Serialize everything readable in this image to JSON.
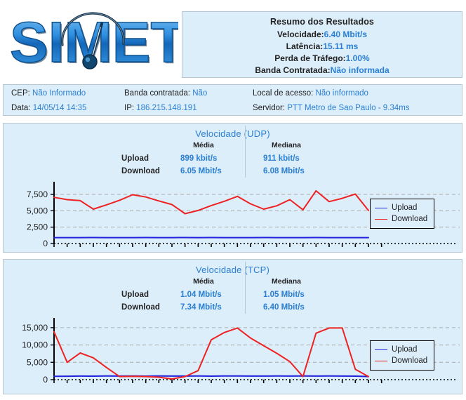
{
  "brand": {
    "name": "SIMET"
  },
  "summary": {
    "title": "Resumo dos Resultados",
    "rows": [
      {
        "label": "Velocidade:",
        "value": "6.40 Mbit/s"
      },
      {
        "label": "Latência:",
        "value": "15.11 ms"
      },
      {
        "label": "Perda de Tráfego:",
        "value": "1.00%"
      },
      {
        "label": "Banda Contratada:",
        "value": "Não informada"
      }
    ]
  },
  "info": {
    "cep_label": "CEP:",
    "cep_value": "Não Informado",
    "banda_label": "Banda contratada:",
    "banda_value": "Não",
    "local_label": "Local de acesso:",
    "local_value": "Não informado",
    "data_label": "Data:",
    "data_value": "14/05/14 14:35",
    "ip_label": "IP:",
    "ip_value": "186.215.148.191",
    "servidor_label": "Servidor:",
    "servidor_value": "PTT Metro de Sao Paulo - 9.34ms"
  },
  "legend": {
    "upload": "Upload",
    "download": "Download"
  },
  "stats_headers": {
    "media": "Média",
    "mediana": "Mediana",
    "upload": "Upload",
    "download": "Download"
  },
  "udp": {
    "title": "Velocidade (UDP)",
    "upload_media": "899 kbit/s",
    "upload_mediana": "911 kbit/s",
    "download_media": "6.05 Mbit/s",
    "download_mediana": "6.08 Mbit/s"
  },
  "tcp": {
    "title": "Velocidade (TCP)",
    "upload_media": "1.04 Mbit/s",
    "upload_mediana": "1.05 Mbit/s",
    "download_media": "7.34 Mbit/s",
    "download_mediana": "6.40 Mbit/s"
  },
  "colors": {
    "panel_bg": "#ddeefb",
    "panel_border": "#b9c6cf",
    "accent_blue": "#2a7fd4",
    "upload_line": "#2222dd",
    "download_line": "#ee2222",
    "grid": "#aaaaaa"
  },
  "chart_data": [
    {
      "type": "line",
      "title": "Velocidade (UDP)",
      "xlabel": "",
      "ylabel": "",
      "ylim": [
        0,
        9000
      ],
      "yticks": [
        0,
        2500,
        5000,
        7500
      ],
      "ytick_labels": [
        "0",
        "2,500",
        "5,000",
        "7,500"
      ],
      "grid": true,
      "legend_position": "right",
      "units": "kbit/s",
      "series": [
        {
          "name": "Upload",
          "color": "#2222dd",
          "values": [
            900,
            905,
            899,
            910,
            895,
            905,
            900,
            911,
            902,
            898,
            906,
            900,
            909,
            897,
            903,
            900,
            908,
            899,
            904,
            900,
            907,
            901,
            898,
            905,
            900
          ]
        },
        {
          "name": "Download",
          "color": "#ee2222",
          "values": [
            7050,
            6700,
            6550,
            5250,
            5900,
            6600,
            7450,
            7100,
            6500,
            5950,
            4550,
            5050,
            5800,
            6450,
            7200,
            6050,
            5250,
            5750,
            6700,
            5150,
            8050,
            6400,
            6900,
            7550,
            5050
          ]
        }
      ]
    },
    {
      "type": "line",
      "title": "Velocidade (TCP)",
      "xlabel": "",
      "ylabel": "",
      "ylim": [
        0,
        17000
      ],
      "yticks": [
        0,
        5000,
        10000,
        15000
      ],
      "ytick_labels": [
        "0",
        "5,000",
        "10,000",
        "15,000"
      ],
      "grid": true,
      "legend_position": "right",
      "units": "kbit/s",
      "series": [
        {
          "name": "Upload",
          "color": "#2222dd",
          "values": [
            950,
            1000,
            1040,
            1020,
            1050,
            1030,
            1045,
            1010,
            1050,
            1040,
            1035,
            1050,
            1020,
            1045,
            1050,
            1030,
            1040,
            1050,
            1025,
            1045,
            1030,
            1050,
            1040,
            1020,
            900
          ]
        },
        {
          "name": "Download",
          "color": "#ee2222",
          "values": [
            13800,
            5000,
            7700,
            6300,
            3500,
            900,
            950,
            900,
            700,
            200,
            900,
            2600,
            11500,
            13600,
            14900,
            12000,
            9800,
            7600,
            5200,
            900,
            13400,
            14900,
            14900,
            3000,
            900
          ]
        }
      ]
    }
  ]
}
